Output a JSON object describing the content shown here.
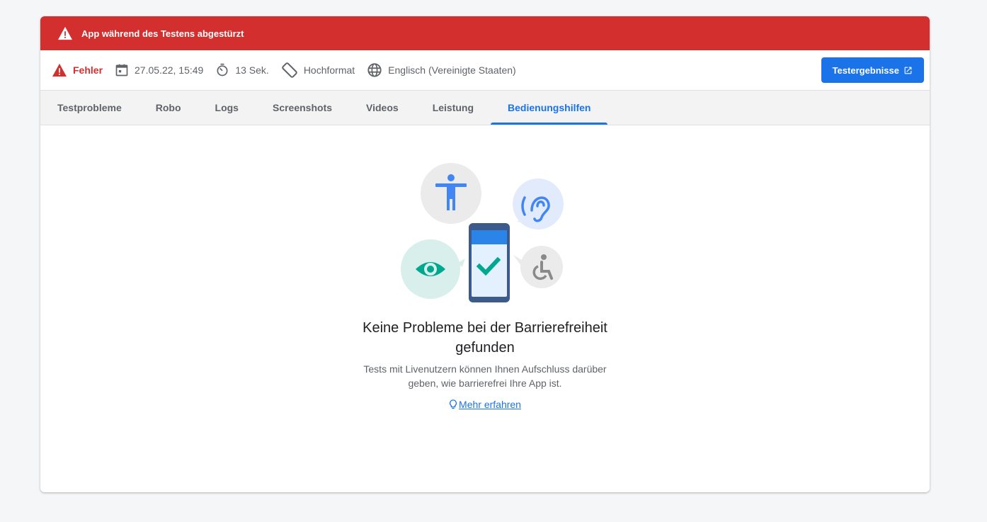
{
  "banner": {
    "text": "App während des Testens abgestürzt"
  },
  "meta": {
    "status": "Fehler",
    "datetime": "27.05.22, 15:49",
    "duration": "13 Sek.",
    "orientation": "Hochformat",
    "locale": "Englisch (Vereinigte Staaten)",
    "results_button": "Testergebnisse"
  },
  "tabs": [
    {
      "label": "Testprobleme"
    },
    {
      "label": "Robo"
    },
    {
      "label": "Logs"
    },
    {
      "label": "Screenshots"
    },
    {
      "label": "Videos"
    },
    {
      "label": "Leistung"
    },
    {
      "label": "Bedienungshilfen",
      "active": true
    }
  ],
  "empty_state": {
    "heading": "Keine Probleme bei der Barrierefreiheit gefunden",
    "description": "Tests mit Livenutzern können Ihnen Aufschluss darüber geben, wie barrierefrei Ihre App ist.",
    "link": "Mehr erfahren"
  },
  "colors": {
    "error": "#d32f2f",
    "accent": "#1a73e8",
    "teal": "#00a890"
  }
}
